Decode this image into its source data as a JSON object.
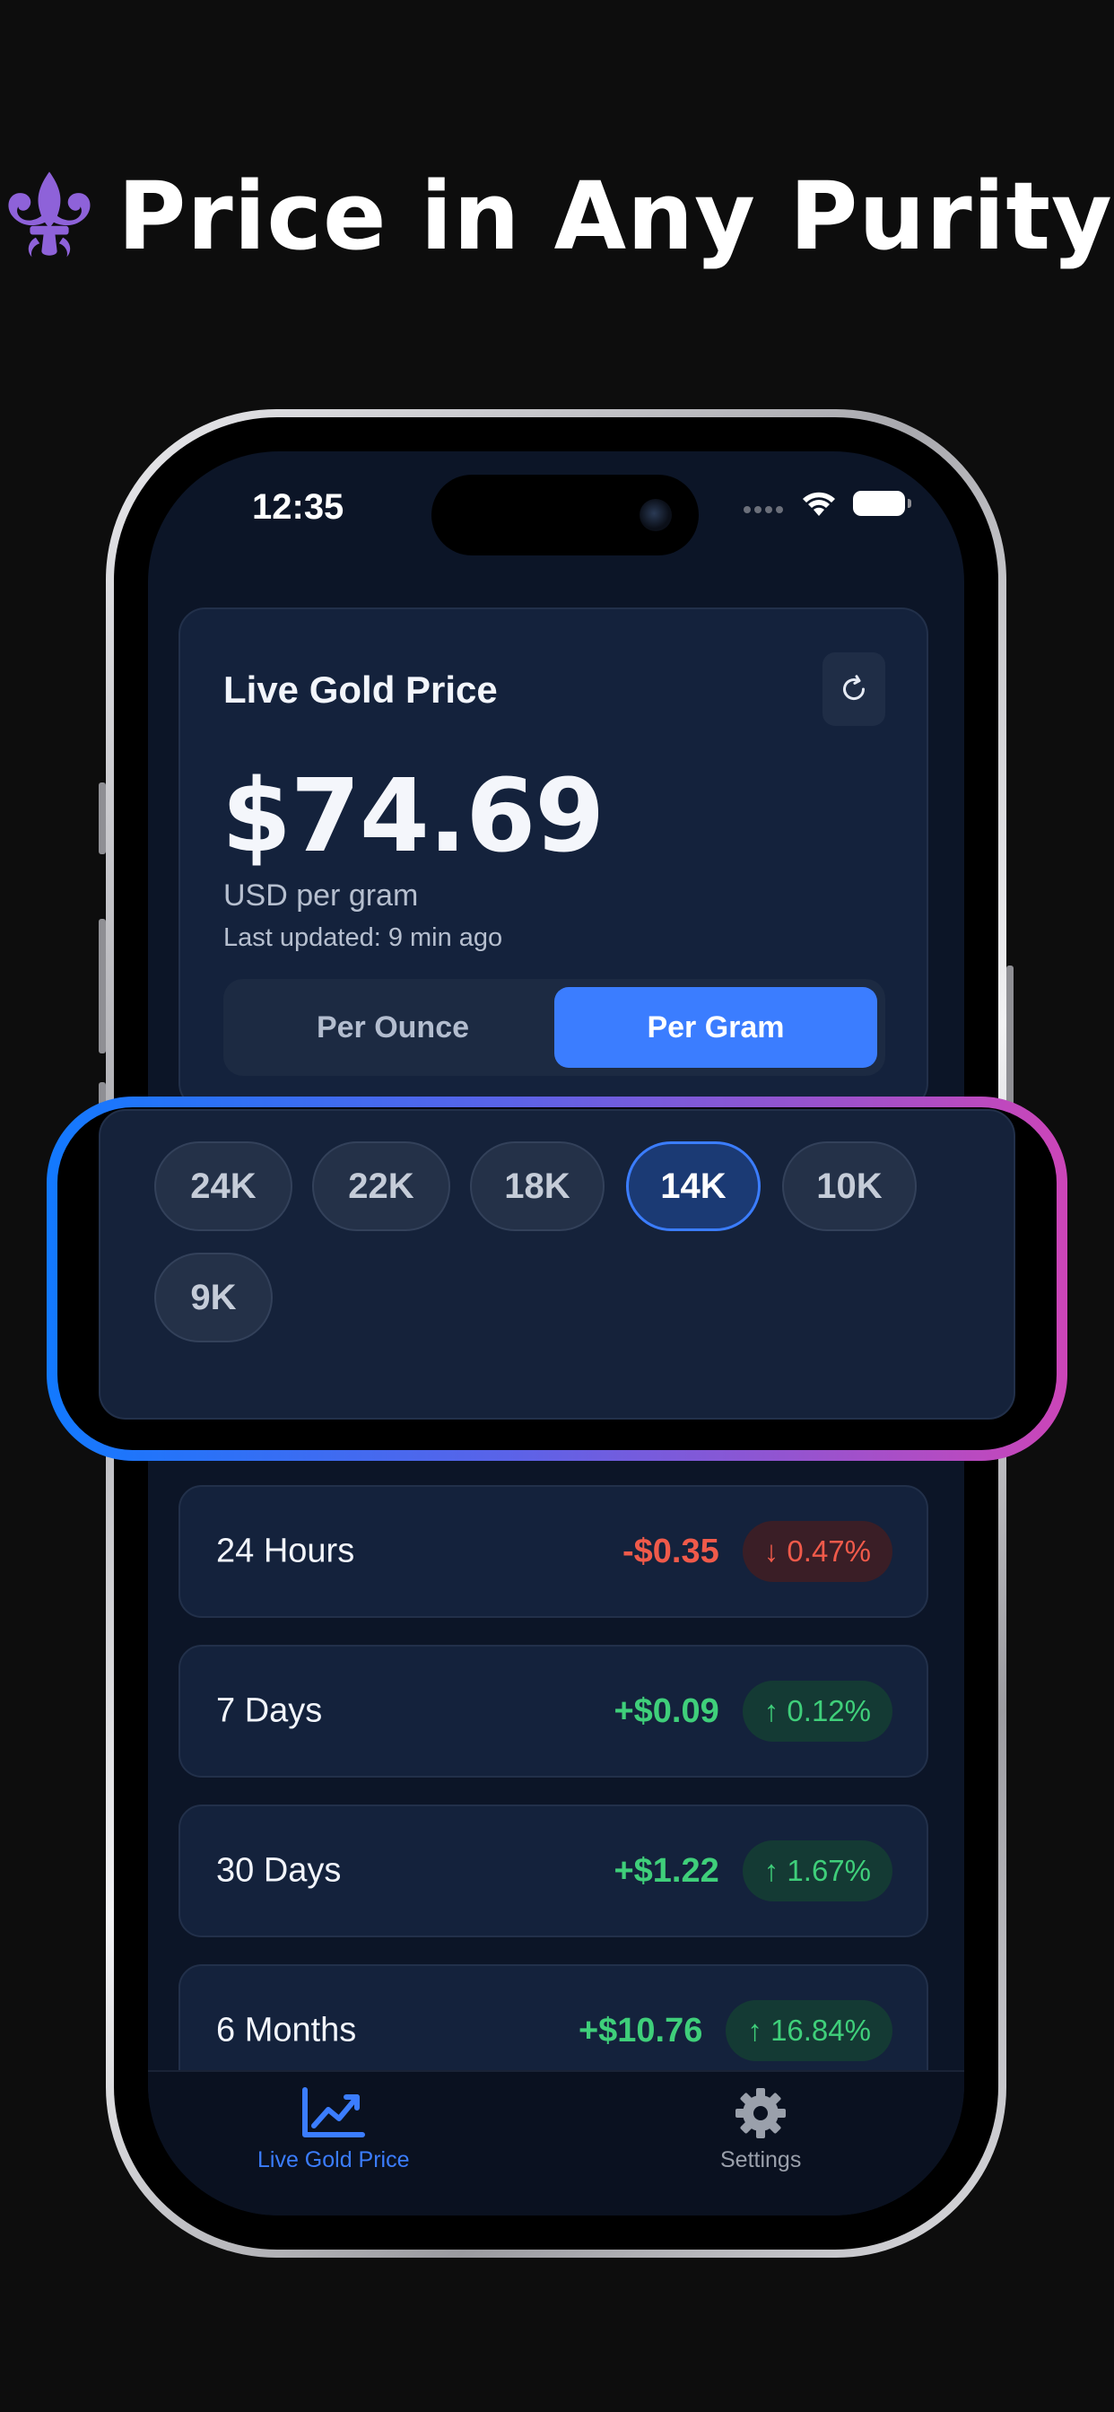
{
  "headline": {
    "text": "Price in Any Purity",
    "icon": "fleur-de-lis-icon"
  },
  "status_bar": {
    "time": "12:35"
  },
  "price_card": {
    "title": "Live Gold Price",
    "price": "$74.69",
    "unit": "USD per gram",
    "last_updated": "Last updated: 9 min ago",
    "toggle": [
      {
        "label": "Per Ounce",
        "active": false
      },
      {
        "label": "Per Gram",
        "active": true
      }
    ]
  },
  "purity": {
    "options": [
      "24K",
      "22K",
      "18K",
      "14K",
      "10K",
      "9K"
    ],
    "selected": "14K"
  },
  "changes": [
    {
      "label": "24 Hours",
      "amount": "-$0.35",
      "percent": "0.47%",
      "direction": "down"
    },
    {
      "label": "7 Days",
      "amount": "+$0.09",
      "percent": "0.12%",
      "direction": "up"
    },
    {
      "label": "30 Days",
      "amount": "+$1.22",
      "percent": "1.67%",
      "direction": "up"
    },
    {
      "label": "6 Months",
      "amount": "+$10.76",
      "percent": "16.84%",
      "direction": "up"
    }
  ],
  "tab_bar": {
    "tabs": [
      {
        "label": "Live Gold Price",
        "icon": "chart-line-icon",
        "active": true
      },
      {
        "label": "Settings",
        "icon": "gear-icon",
        "active": false
      }
    ]
  },
  "colors": {
    "accent": "#3b7dff",
    "positive": "#3fcf7a",
    "negative": "#f05a4a",
    "highlight_start": "#1279ff",
    "highlight_end": "#cc45b8",
    "headline_icon": "#8e62d9"
  }
}
